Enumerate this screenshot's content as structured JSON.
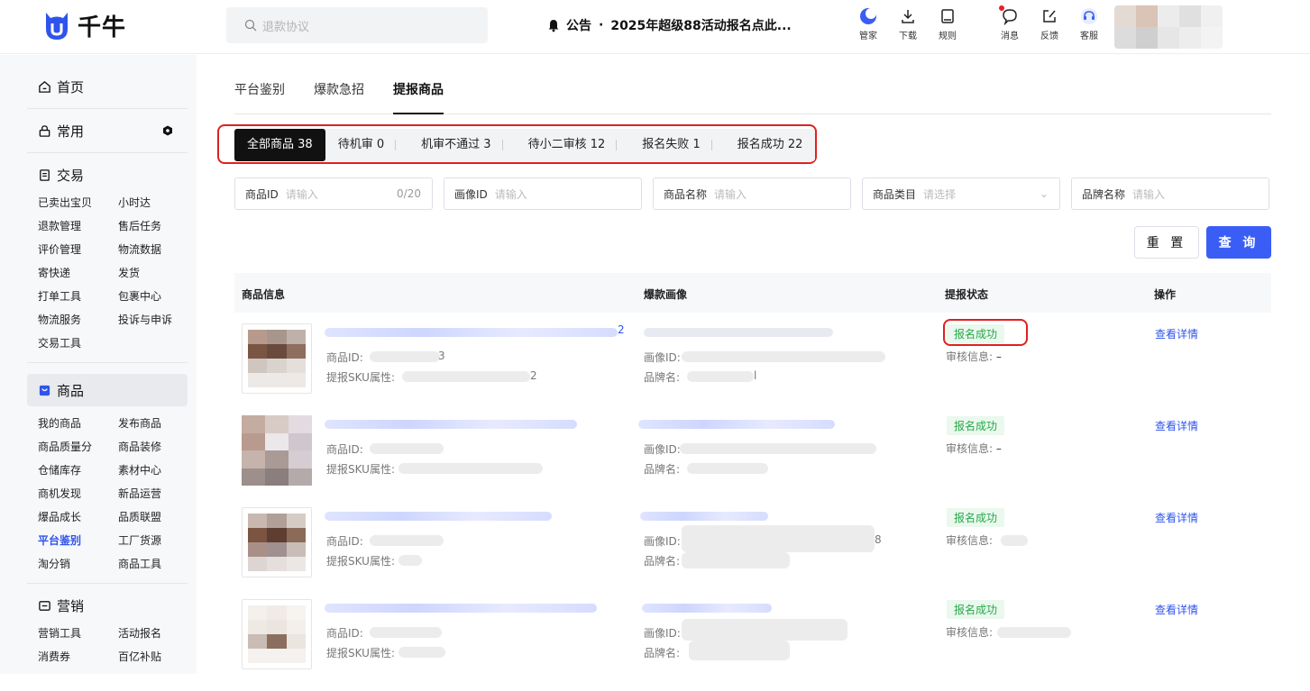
{
  "header": {
    "logo_text": "千牛",
    "search_placeholder": "退款协议",
    "notice_label": "公告",
    "notice_dot": "·",
    "notice_text": "2025年超级88活动报名点此...",
    "icons": [
      {
        "name": "manager-icon",
        "label": "管家"
      },
      {
        "name": "download-icon",
        "label": "下载"
      },
      {
        "name": "rules-icon",
        "label": "规则"
      },
      {
        "name": "message-icon",
        "label": "消息"
      },
      {
        "name": "feedback-icon",
        "label": "反馈"
      },
      {
        "name": "service-icon",
        "label": "客服"
      }
    ],
    "colors": {
      "brand": "#2f54eb",
      "alert": "#e5212a"
    }
  },
  "sidebar": {
    "home": "首页",
    "common": "常用",
    "trade": {
      "title": "交易",
      "items": [
        "已卖出宝贝",
        "小时达",
        "退款管理",
        "售后任务",
        "评价管理",
        "物流数据",
        "寄快递",
        "发货",
        "打单工具",
        "包裹中心",
        "物流服务",
        "投诉与申诉",
        "交易工具"
      ]
    },
    "goods": {
      "title": "商品",
      "items": [
        "我的商品",
        "发布商品",
        "商品质量分",
        "商品装修",
        "仓储库存",
        "素材中心",
        "商机发现",
        "新品运营",
        "爆品成长",
        "品质联盟",
        "平台鉴别",
        "工厂货源",
        "淘分销",
        "商品工具"
      ],
      "active": "平台鉴别"
    },
    "marketing": {
      "title": "营销",
      "items": [
        "营销工具",
        "活动报名",
        "消费券",
        "百亿补贴"
      ]
    }
  },
  "main": {
    "tabs": [
      "平台鉴别",
      "爆款急招",
      "提报商品"
    ],
    "active_tab": "提报商品",
    "segments": [
      {
        "label": "全部商品",
        "count": "38"
      },
      {
        "label": "待机审",
        "count": "0"
      },
      {
        "label": "机审不通过",
        "count": "3"
      },
      {
        "label": "待小二审核",
        "count": "12"
      },
      {
        "label": "报名失败",
        "count": "1"
      },
      {
        "label": "报名成功",
        "count": "22"
      }
    ],
    "filters": [
      {
        "label": "商品ID",
        "placeholder": "请输入",
        "counter": "0/20"
      },
      {
        "label": "画像ID",
        "placeholder": "请输入"
      },
      {
        "label": "商品名称",
        "placeholder": "请输入"
      },
      {
        "label": "商品类目",
        "placeholder": "请选择",
        "chevron": "⌄"
      },
      {
        "label": "品牌名称",
        "placeholder": "请输入"
      }
    ],
    "reset_label": "重 置",
    "query_label": "查 询",
    "columns": [
      "商品信息",
      "爆款画像",
      "提报状态",
      "操作"
    ],
    "row_labels": {
      "product_id": "商品ID:",
      "sku": "提报SKU属性:",
      "portrait_id": "画像ID:",
      "brand": "品牌名:",
      "audit": "审核信息:"
    },
    "rows": [
      {
        "title_suffix": "2",
        "id_suffix": "3",
        "sku_suffix": "2",
        "portrait_suffix": "",
        "brand_suffix": "l",
        "status": "报名成功",
        "audit": "–",
        "action": "查看详情"
      },
      {
        "title_suffix": "",
        "id_suffix": "",
        "sku_suffix": "",
        "portrait_suffix": "",
        "brand_suffix": "",
        "status": "报名成功",
        "audit": "–",
        "action": "查看详情"
      },
      {
        "title_suffix": "",
        "id_suffix": "",
        "sku_suffix": "",
        "portrait_suffix": "8",
        "brand_suffix": "",
        "status": "报名成功",
        "audit": "",
        "action": "查看详情"
      },
      {
        "title_suffix": "",
        "id_suffix": "",
        "sku_suffix": "",
        "portrait_suffix": "",
        "brand_suffix": "",
        "status": "报名成功",
        "audit": "",
        "action": "查看详情"
      }
    ]
  }
}
